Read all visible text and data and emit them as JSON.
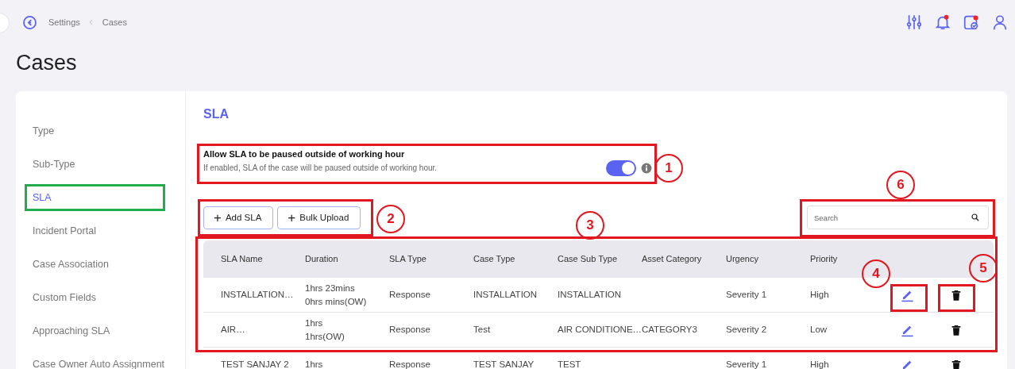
{
  "topbar": {
    "breadcrumb": [
      "Settings",
      "Cases"
    ],
    "icons": [
      {
        "kind": "sliders",
        "dot": false
      },
      {
        "kind": "bell",
        "dot": true
      },
      {
        "kind": "calendar",
        "dot": true
      },
      {
        "kind": "user",
        "dot": false
      }
    ]
  },
  "page_title": "Cases",
  "sidebar": {
    "items": [
      {
        "label": "Type",
        "selected": false
      },
      {
        "label": "Sub-Type",
        "selected": false
      },
      {
        "label": "SLA",
        "selected": true
      },
      {
        "label": "Incident Portal",
        "selected": false
      },
      {
        "label": "Case Association",
        "selected": false
      },
      {
        "label": "Custom Fields",
        "selected": false
      },
      {
        "label": "Approaching SLA",
        "selected": false
      },
      {
        "label": "Case Owner Auto Assignment",
        "selected": false
      }
    ]
  },
  "panel": {
    "title": "SLA",
    "pause_setting": {
      "title": "Allow SLA to be paused outside of working hour",
      "description": "If enabled, SLA of the case will be paused outside of working hour.",
      "on": true
    },
    "buttons": [
      {
        "icon": "+",
        "label": "Add SLA"
      },
      {
        "icon": "+",
        "label": "Bulk Upload"
      }
    ],
    "search": {
      "placeholder": "Search"
    }
  },
  "table": {
    "columns": [
      "SLA Name",
      "Duration",
      "SLA Type",
      "Case Type",
      "Case Sub Type",
      "Asset Category",
      "Urgency",
      "Priority"
    ],
    "rows": [
      {
        "cells": [
          "INSTALLATION…",
          [
            "1hrs 23mins",
            "0hrs mins(OW)"
          ],
          "Response",
          "INSTALLATION",
          "INSTALLATION",
          "",
          "Severity 1",
          "High"
        ]
      },
      {
        "cells": [
          "AIR…",
          [
            "1hrs",
            "1hrs(OW)"
          ],
          "Response",
          "Test",
          "AIR CONDITIONE…",
          "CATEGORY3",
          "Severity 2",
          "Low"
        ]
      },
      {
        "cells": [
          "TEST SANJAY 2",
          [
            "1hrs"
          ],
          "Response",
          "TEST SANJAY",
          "TEST",
          "",
          "Severity 1",
          "High"
        ]
      }
    ]
  },
  "annotations": [
    {
      "color": "#22ad4c"
    },
    {
      "label": "1",
      "color": "#e3171f"
    },
    {
      "label": "2",
      "color": "#e3171f"
    },
    {
      "label": "3",
      "color": "#e3171f"
    },
    {
      "label": "6",
      "color": "#e3171f"
    },
    {
      "label": "4",
      "color": "#e3171f"
    },
    {
      "label": "5",
      "color": "#e3171f"
    }
  ]
}
